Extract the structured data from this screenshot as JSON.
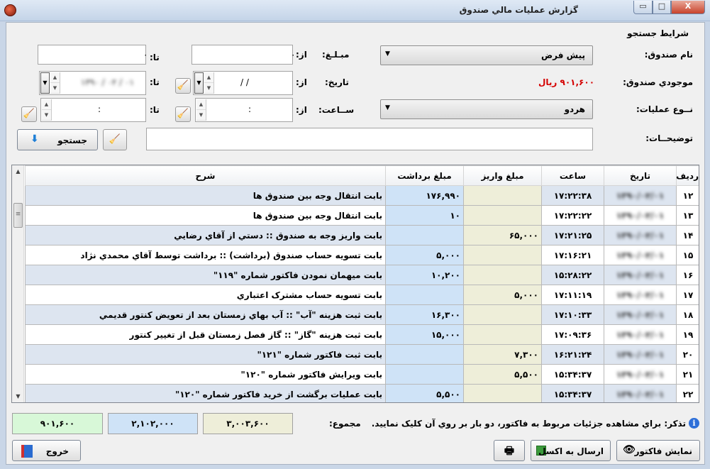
{
  "window": {
    "title": "گزارش عمليات مالي صندوق",
    "close": "X",
    "max": "□",
    "min": "▭"
  },
  "search": {
    "group_title": "شرايط جستجو",
    "fund_name_label": "نام صندوق:",
    "fund_name_value": "پيش فرض",
    "fund_balance_label": "موجودي صندوق:",
    "fund_balance_value": "۹۰۱,۶۰۰ ريال",
    "operation_type_label": "نــوع عمليات:",
    "operation_type_value": "هردو",
    "description_label": "توضيحــات:",
    "amount_label": "مبـلـغ:",
    "date_label": "تاريخ:",
    "time_label": "ســاعت:",
    "from_label": "از:",
    "to_label": "تا:",
    "amount_from_value": "۰",
    "amount_to_value": "۰",
    "date_from_value": "/  /",
    "date_to_value": "۱۳۹۰ / ۰۲ / ۰۱",
    "time_from_value": ":",
    "time_to_value": ":",
    "search_button": "جستجو"
  },
  "table": {
    "columns": [
      "رديف",
      "تاريخ",
      "ساعت",
      "مبلغ واريز",
      "مبلغ برداشت",
      "شرح"
    ],
    "rows": [
      {
        "row": "۱۲",
        "date": "۱۳۹۰/۰۲/۰۱",
        "time": "۱۷:۲۲:۳۸",
        "deposit": "",
        "withdraw": "۱۷۶,۹۹۰",
        "desc": "بابت انتقال وجه بين صندوق ها"
      },
      {
        "row": "۱۳",
        "date": "۱۳۹۰/۰۲/۰۱",
        "time": "۱۷:۲۲:۲۲",
        "deposit": "",
        "withdraw": "۱۰",
        "desc": "بابت انتقال وجه بين صندوق ها"
      },
      {
        "row": "۱۴",
        "date": "۱۳۹۰/۰۲/۰۱",
        "time": "۱۷:۲۱:۲۵",
        "deposit": "۶۵,۰۰۰",
        "withdraw": "",
        "desc": "بابت واريز وجه به صندوق :: دستي از آقاي رضايي"
      },
      {
        "row": "۱۵",
        "date": "۱۳۹۰/۰۲/۰۱",
        "time": "۱۷:۱۶:۲۱",
        "deposit": "",
        "withdraw": "۵,۰۰۰",
        "desc": "بابت تسويه حساب صندوق (برداشت) :: برداشت توسط آقاي محمدي نژاد"
      },
      {
        "row": "۱۶",
        "date": "۱۳۹۰/۰۲/۰۱",
        "time": "۱۵:۲۸:۲۲",
        "deposit": "",
        "withdraw": "۱۰,۲۰۰",
        "desc": "بابت ميهمان نمودن فاكتور شماره \"۱۱۹\""
      },
      {
        "row": "۱۷",
        "date": "۱۳۹۰/۰۲/۰۱",
        "time": "۱۷:۱۱:۱۹",
        "deposit": "۵,۰۰۰",
        "withdraw": "",
        "desc": "بابت تسويه حساب مشترک اعتباري"
      },
      {
        "row": "۱۸",
        "date": "۱۳۹۰/۰۲/۰۱",
        "time": "۱۷:۱۰:۳۳",
        "deposit": "",
        "withdraw": "۱۶,۳۰۰",
        "desc": "بابت ثبت هزينه \"آب\" :: آب بهاي زمستان بعد از تعويض كنتور قديمي"
      },
      {
        "row": "۱۹",
        "date": "۱۳۹۰/۰۲/۰۱",
        "time": "۱۷:۰۹:۳۶",
        "deposit": "",
        "withdraw": "۱۵,۰۰۰",
        "desc": "بابت ثبت هزينه \"گاز\" :: گاز فصل زمستان قبل از تغيير كنتور"
      },
      {
        "row": "۲۰",
        "date": "۱۳۹۰/۰۲/۰۱",
        "time": "۱۶:۲۱:۲۴",
        "deposit": "۷,۳۰۰",
        "withdraw": "",
        "desc": "بابت ثبت فاكتور شماره \"۱۲۱\""
      },
      {
        "row": "۲۱",
        "date": "۱۳۹۰/۰۲/۰۱",
        "time": "۱۵:۳۴:۳۷",
        "deposit": "۵,۵۰۰",
        "withdraw": "",
        "desc": "بابت ويرايش فاكتور شماره \"۱۲۰\""
      },
      {
        "row": "۲۲",
        "date": "۱۳۹۰/۰۲/۰۱",
        "time": "۱۵:۳۴:۳۷",
        "deposit": "",
        "withdraw": "۵,۵۰۰",
        "desc": "بابت عمليات برگشت از خريد فاكتور شماره \"۱۲۰\""
      }
    ]
  },
  "footer": {
    "note": "تذكر: براي مشاهده جزئيات مربوط به فاكتور، دو بار بر روي آن كليک نماييد.",
    "sum_label": "مجموع:",
    "sum_deposit": "۳,۰۰۳,۶۰۰",
    "sum_withdraw": "۲,۱۰۲,۰۰۰",
    "sum_balance": "۹۰۱,۶۰۰",
    "show_invoice_button": "نمايش فاكتور",
    "export_excel_button": "ارسال به اكسل",
    "exit_button": "خروج"
  },
  "colors": {
    "balance_red": "#d40000",
    "deposit_bg": "#eeeed9",
    "withdraw_bg": "#cfe3f7",
    "sum_balance_bg": "#d8f8d8"
  }
}
